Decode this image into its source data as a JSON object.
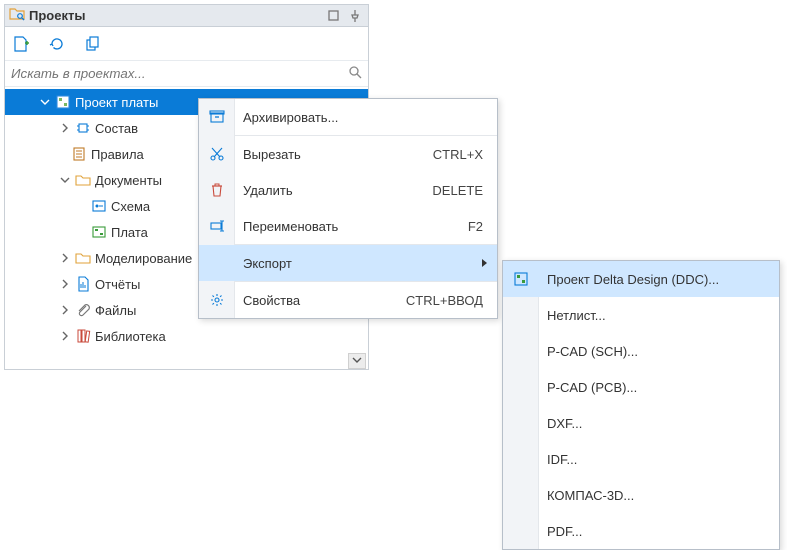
{
  "panel": {
    "title": "Проекты",
    "search_placeholder": "Искать в проектах..."
  },
  "tree": {
    "root": {
      "label": "Проект платы"
    },
    "items": [
      {
        "label": "Состав"
      },
      {
        "label": "Правила"
      },
      {
        "label": "Документы"
      },
      {
        "label": "Схема"
      },
      {
        "label": "Плата"
      },
      {
        "label": "Моделирование"
      },
      {
        "label": "Отчёты"
      },
      {
        "label": "Файлы"
      },
      {
        "label": "Библиотека"
      }
    ]
  },
  "context_menu": {
    "items": [
      {
        "label": "Архивировать...",
        "shortcut": ""
      },
      {
        "label": "Вырезать",
        "shortcut": "CTRL+X"
      },
      {
        "label": "Удалить",
        "shortcut": "DELETE"
      },
      {
        "label": "Переименовать",
        "shortcut": "F2"
      },
      {
        "label": "Экспорт",
        "shortcut": ""
      },
      {
        "label": "Свойства",
        "shortcut": "CTRL+ВВОД"
      }
    ]
  },
  "submenu": {
    "items": [
      {
        "label": "Проект Delta Design (DDC)..."
      },
      {
        "label": "Нетлист..."
      },
      {
        "label": "P-CAD (SCH)..."
      },
      {
        "label": "P-CAD (PCB)..."
      },
      {
        "label": "DXF..."
      },
      {
        "label": "IDF..."
      },
      {
        "label": "КОМПАС-3D..."
      },
      {
        "label": "PDF..."
      }
    ]
  }
}
